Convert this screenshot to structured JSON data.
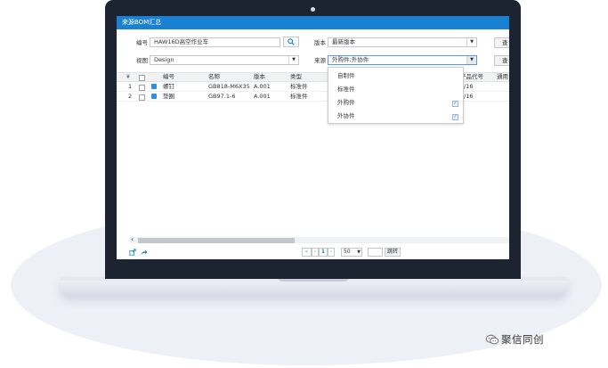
{
  "window": {
    "title": "来源BOM汇总"
  },
  "filters": {
    "code_label": "编号",
    "code_value": "HAW16D高空作业车",
    "version_label": "版本",
    "version_value": "最新版本",
    "view_label": "视图",
    "view_value": "Design",
    "source_label": "来源",
    "source_value": "外购件;外协件",
    "side_button_1": "查",
    "side_button_2": "查"
  },
  "grid": {
    "headers": [
      "编号",
      "名称",
      "版本",
      "类型",
      "产品代号",
      "通用"
    ],
    "rows": [
      {
        "index": "1",
        "code": "螺钉",
        "name": "GB818-M6X35",
        "version": "A.001",
        "type": "标准件",
        "product_code": "/16"
      },
      {
        "index": "2",
        "code": "垫圈",
        "name": "GB97.1-6",
        "version": "A.001",
        "type": "标准件",
        "product_code": "/16"
      }
    ]
  },
  "source_dropdown": {
    "options": [
      {
        "label": "自制件",
        "checked": false
      },
      {
        "label": "标准件",
        "checked": false
      },
      {
        "label": "外购件",
        "checked": true
      },
      {
        "label": "外协件",
        "checked": true
      }
    ]
  },
  "pager": {
    "page": "1",
    "page_size": "50",
    "jump_label": "跳转"
  },
  "brand": {
    "text": "聚信同创"
  },
  "icons": {
    "search": "search-icon",
    "export": "export-icon",
    "share": "share-icon",
    "prev": "chevron-left-icon",
    "first": "double-chevron-left-icon"
  },
  "colors": {
    "titlebar": "#1a80d1",
    "bezel": "#1c2431"
  }
}
